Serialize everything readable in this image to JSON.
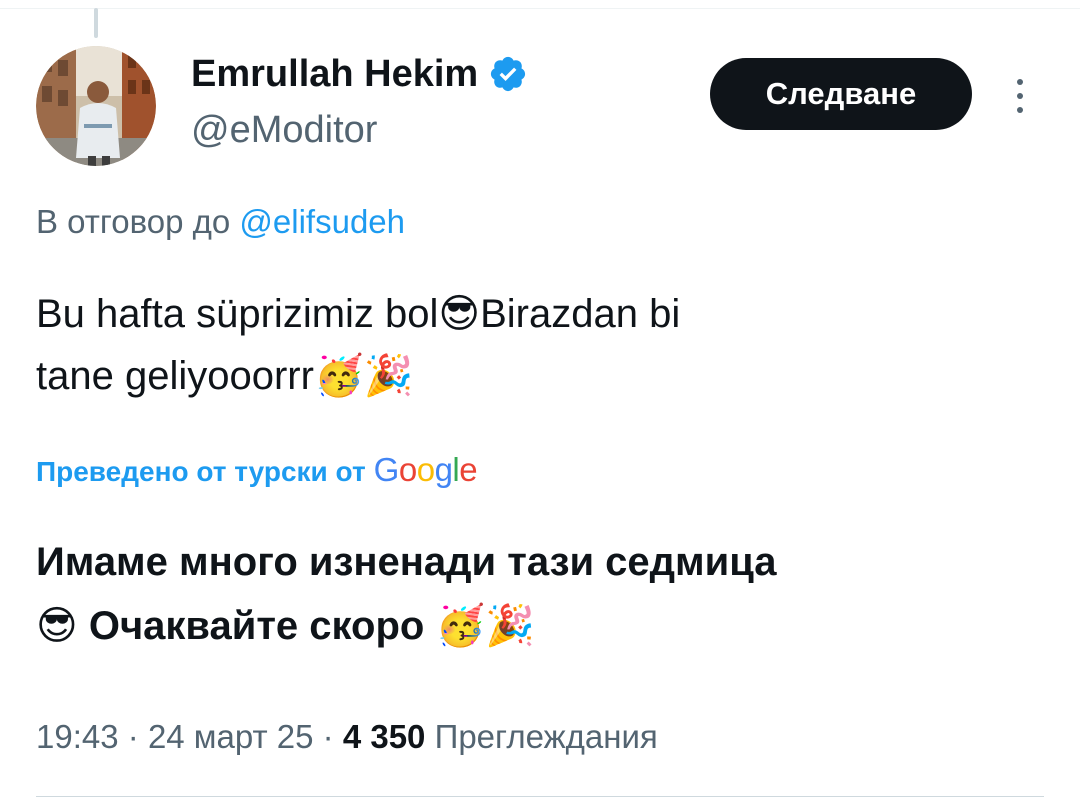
{
  "author": {
    "name": "Emrullah Hekim",
    "handle": "@eModitor",
    "verified": true
  },
  "follow_button": {
    "label": "Следване"
  },
  "reply_context": {
    "prefix": "В отговор до",
    "mention": "@elifsudeh"
  },
  "tweet": {
    "line1_text": "Bu hafta süprizimiz bol",
    "line1_emoji": "😎",
    "line1_tail": "Birazdan bi",
    "line2_text": "tane geliyooorrr",
    "line2_emojis": "🥳🎉"
  },
  "translation": {
    "label": "Преведено от турски от",
    "provider": "Google",
    "line1": "Имаме много изненади тази седмица",
    "line2_emoji": "😎",
    "line2_text": "Очаквайте скоро",
    "line2_emojis": "🥳🎉"
  },
  "meta": {
    "time": "19:43",
    "separator": "·",
    "date": "24 март 25",
    "views_count": "4 350",
    "views_label": "Преглеждания"
  },
  "colors": {
    "accent": "#1d9bf0",
    "text_primary": "#0f1419",
    "text_secondary": "#536471",
    "button_bg": "#0f1419"
  },
  "icons": {
    "verified": "verified-badge-icon",
    "more": "more-vertical-icon"
  }
}
